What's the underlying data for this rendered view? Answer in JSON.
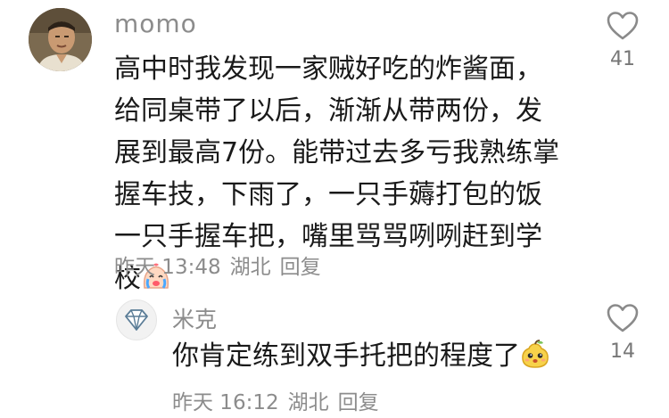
{
  "comment": {
    "author": "momo",
    "text": "高中时我发现一家贼好吃的炸酱面，给同桌带了以后，渐渐从带两份，发展到最高7份。能带过去多亏我熟练掌握车技，下雨了，一只手薅打包的饭一只手握车把，嘴里骂骂咧咧赶到学校",
    "emoji": "crying-face-emoji",
    "time": "昨天 13:48",
    "location": "湖北",
    "reply_label": "回复",
    "likes": "41"
  },
  "reply": {
    "author": "米克",
    "text": "你肯定练到双手托把的程度了",
    "emoji": "pear-face-emoji",
    "time": "昨天 16:12",
    "location": "湖北",
    "reply_label": "回复",
    "likes": "14"
  },
  "colors": {
    "text": "#1a1a1a",
    "muted": "#8c8c8c",
    "like_count": "#777777"
  }
}
